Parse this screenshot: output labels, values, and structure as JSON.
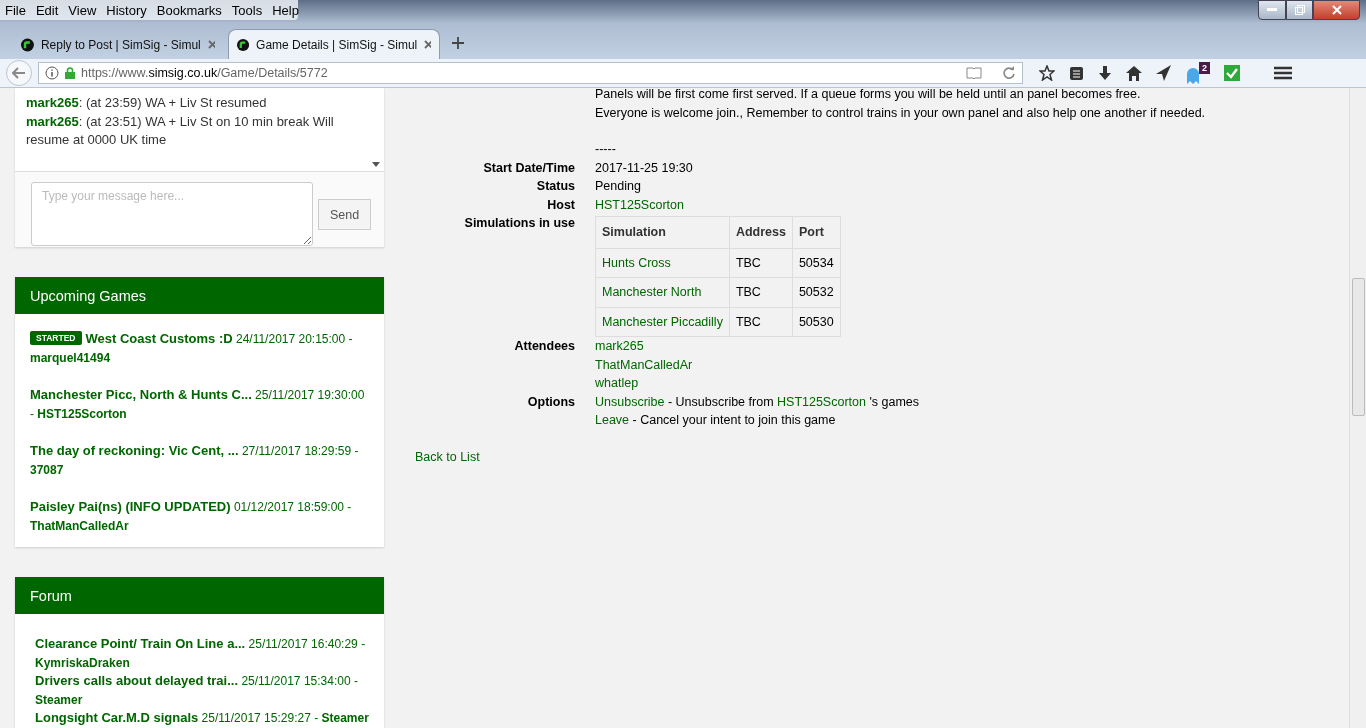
{
  "menu": [
    "File",
    "Edit",
    "View",
    "History",
    "Bookmarks",
    "Tools",
    "Help"
  ],
  "tabs": [
    {
      "title": "Reply to Post | SimSig - Simul",
      "selected": false
    },
    {
      "title": "Game Details | SimSig - Simul",
      "selected": true
    }
  ],
  "address": {
    "prefix": "https://www.",
    "domain": "simsig.co.uk",
    "path": "/Game/Details/5772"
  },
  "toolbar": {
    "badge": "2"
  },
  "chat": {
    "messages": [
      {
        "user": "mark265",
        "text": ": (at 23:59) WA + Liv St resumed"
      },
      {
        "user": "mark265",
        "text": ": (at 23:51) WA + Liv St on 10 min break Will resume at 0000 UK time"
      }
    ],
    "placeholder": "Type your message here...",
    "send": "Send"
  },
  "upcoming": {
    "title": "Upcoming Games",
    "items": [
      {
        "badge": "STARTED",
        "title": "West Coast Customs :D",
        "date": "24/11/2017 20:15:00 -",
        "user": "marquel41494"
      },
      {
        "title": "Manchester Picc, North & Hunts C...",
        "date": "25/11/2017 19:30:00 -",
        "user": "HST125Scorton"
      },
      {
        "title": "The day of reckoning: Vic Cent, ...",
        "date": "27/11/2017 18:29:59 -",
        "user": "37087"
      },
      {
        "title": "Paisley Pai(ns) (INFO UPDATED)",
        "date": "01/12/2017 18:59:00 -",
        "user": "ThatManCalledAr"
      }
    ]
  },
  "forum": {
    "title": "Forum",
    "items": [
      {
        "title": "Clearance Point/ Train On Line a...",
        "date": "25/11/2017 16:40:29 -",
        "user": "KymriskaDraken"
      },
      {
        "title": "Drivers calls about delayed trai...",
        "date": "25/11/2017 15:34:00 -",
        "user": "Steamer"
      },
      {
        "title": "Longsight Car.M.D signals",
        "date": "25/11/2017 15:29:27 -",
        "user": "Steamer"
      }
    ]
  },
  "details": {
    "intro": [
      "Panels will be first come first served. If a queue forms you will be held until an panel becomes free.",
      "Everyone is welcome join., Remember to control trains in your own panel and also help one another if needed."
    ],
    "separator": "-----",
    "start_label": "Start Date/Time",
    "start": "2017-11-25 19:30",
    "status_label": "Status",
    "status": "Pending",
    "host_label": "Host",
    "host": "HST125Scorton",
    "sims_label": "Simulations in use",
    "sims_columns": [
      "Simulation",
      "Address",
      "Port"
    ],
    "sims_rows": [
      [
        "Hunts Cross",
        "TBC",
        "50534"
      ],
      [
        "Manchester North",
        "TBC",
        "50532"
      ],
      [
        "Manchester Piccadilly",
        "TBC",
        "50530"
      ]
    ],
    "attendees_label": "Attendees",
    "attendees": [
      "mark265",
      "ThatManCalledAr",
      "whatlep"
    ],
    "options_label": "Options",
    "options": [
      {
        "link": "Unsubscribe",
        "text": " - Unsubscribe from ",
        "host": "HST125Scorton",
        "tail": " 's games"
      },
      {
        "link": "Leave",
        "text": " - Cancel your intent to join this game"
      }
    ],
    "back": "Back to List"
  }
}
